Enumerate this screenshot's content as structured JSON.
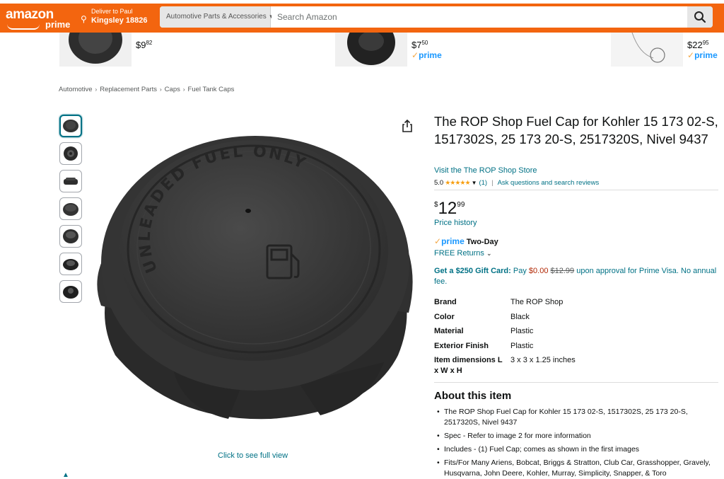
{
  "header": {
    "logo_text": "amazon",
    "logo_sub": "prime",
    "deliver_line1": "Deliver to Paul",
    "deliver_line2": "Kingsley 18826",
    "search_category": "Automotive Parts & Accessories",
    "search_placeholder": "Search Amazon",
    "bar_color": "#f3650f"
  },
  "related": [
    {
      "price_whole": "$9",
      "price_frac": "82",
      "prime": false
    },
    {
      "price_whole": "$7",
      "price_frac": "50",
      "prime": true,
      "prime_label": "prime"
    },
    {
      "price_whole": "$22",
      "price_frac": "95",
      "prime": true,
      "prime_label": "prime"
    }
  ],
  "breadcrumb": [
    "Automotive",
    "Replacement Parts",
    "Caps",
    "Fuel Tank Caps"
  ],
  "gallery": {
    "thumbnail_count": 7,
    "active_index": 0,
    "full_view_label": "Click to see full view",
    "image_embossed_text": "UNLEADED FUEL ONLY"
  },
  "product": {
    "title": "The ROP Shop Fuel Cap for Kohler 15 173 02-S, 1517302S, 25 173 20-S, 2517320S, Nivel 9437",
    "store_link": "Visit the The ROP Shop Store",
    "rating_value": "5.0",
    "rating_stars": 5,
    "rating_count": "(1)",
    "qa_link": "Ask questions and search reviews",
    "price_symbol": "$",
    "price_whole": "12",
    "price_fraction": "99",
    "price_history": "Price history",
    "prime_label": "prime",
    "delivery_speed": "Two-Day",
    "free_returns": "FREE Returns",
    "gift_card": {
      "lead": "Get a $250 Gift Card:",
      "pay": "Pay",
      "new_price": "$0.00",
      "old_price": "$12.99",
      "tail": "upon approval for Prime Visa. No annual fee."
    }
  },
  "specs": [
    {
      "key": "Brand",
      "value": "The ROP Shop"
    },
    {
      "key": "Color",
      "value": "Black"
    },
    {
      "key": "Material",
      "value": "Plastic"
    },
    {
      "key": "Exterior Finish",
      "value": "Plastic"
    },
    {
      "key": "Item dimensions L x W x H",
      "value": "3 x 3 x 1.25 inches"
    }
  ],
  "about": {
    "heading": "About this item",
    "bullets": [
      "The ROP Shop Fuel Cap for Kohler 15 173 02-S, 1517302S, 25 173 20-S, 2517320S, Nivel 9437",
      "Spec - Refer to image 2 for more information",
      "Includes - (1) Fuel Cap; comes as shown in the first images",
      "Fits/For Many Ariens, Bobcat, Briggs & Stratton, Club Car, Grasshopper, Gravely, Husqvarna, John Deere, Kohler, Murray, Simplicity, Snapper, & Toro"
    ]
  }
}
